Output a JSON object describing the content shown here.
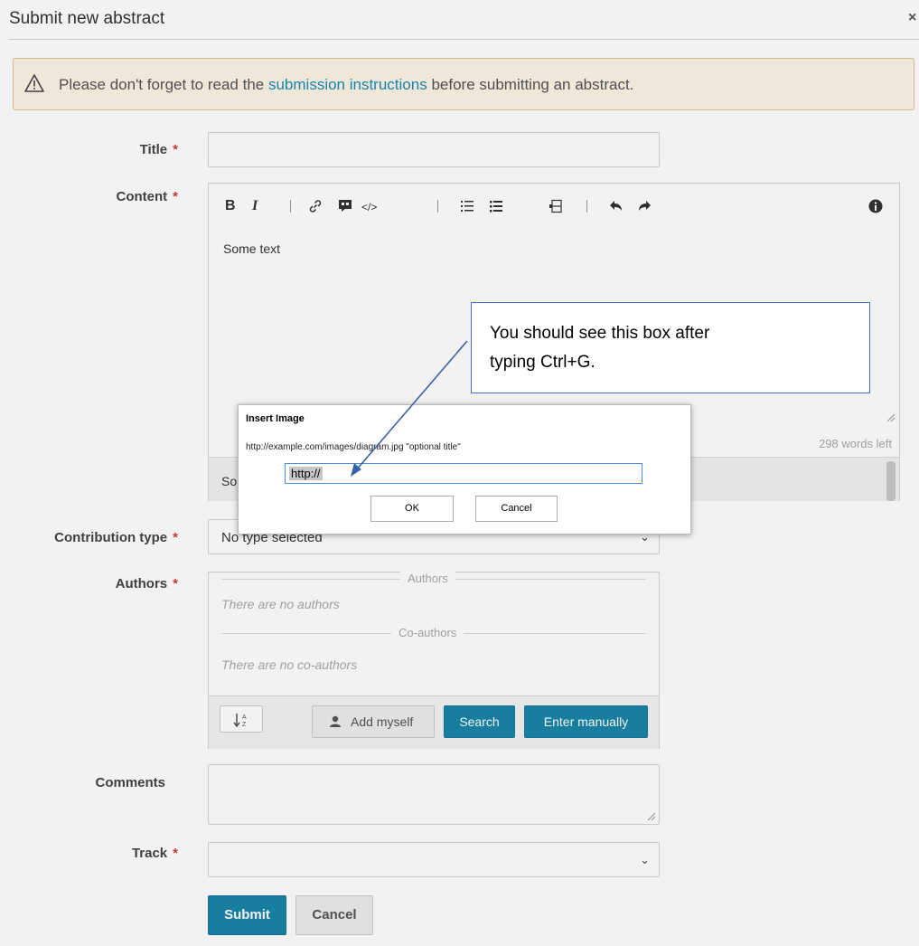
{
  "dialog": {
    "title": "Submit new abstract",
    "close": "×"
  },
  "warning": {
    "prefix": "Please don't forget to read the ",
    "link": "submission instructions",
    "suffix": " before submitting an abstract."
  },
  "form": {
    "title_label": "Title",
    "content_label": "Content",
    "required_mark": "*",
    "editor": {
      "toolbar": [
        "bold-icon",
        "italic-icon",
        "link-icon",
        "quote-icon",
        "code-icon",
        "numbered-list-icon",
        "bulleted-list-icon",
        "heading-icon",
        "undo-icon",
        "redo-icon",
        "info-icon"
      ],
      "content": "Some text",
      "words_left": "298 words left",
      "preview_text": "So"
    },
    "contribution_type": {
      "label": "Contribution type",
      "value": "No type selected"
    },
    "authors": {
      "label": "Authors",
      "authors_heading": "Authors",
      "no_authors": "There are no authors",
      "coauthors_heading": "Co-authors",
      "no_coauthors": "There are no co-authors",
      "add_myself": "Add myself",
      "search": "Search",
      "enter_manually": "Enter manually"
    },
    "comments_label": "Comments",
    "track_label": "Track",
    "submit": "Submit",
    "cancel": "Cancel"
  },
  "insert_image_dialog": {
    "title": "Insert Image",
    "hint": "http://example.com/images/diagram.jpg \"optional title\"",
    "input_value": "http://",
    "ok": "OK",
    "cancel": "Cancel"
  },
  "annotation": {
    "line1": "You should see this box after",
    "line2": "typing Ctrl+G."
  },
  "colors": {
    "primary_blue": "#1a85a8",
    "link_blue": "#1a8bb8",
    "required_red": "#d23c3c",
    "callout_border": "#4472c4"
  }
}
